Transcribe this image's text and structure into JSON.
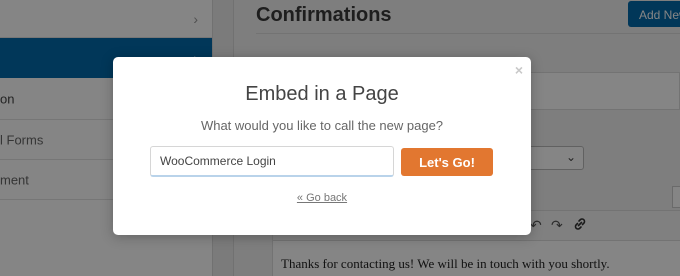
{
  "sidebar": {
    "items": [
      {
        "label": ""
      },
      {
        "label": ""
      },
      {
        "label": "on"
      },
      {
        "label": "l Forms"
      },
      {
        "label": "ment"
      }
    ]
  },
  "main": {
    "title": "Confirmations",
    "add_new_label": "Add New",
    "editor_text": "Thanks for contacting us! We will be in touch with you shortly."
  },
  "icons": {
    "chevron": "chevron-right-icon",
    "undo": "undo-icon",
    "redo": "redo-icon",
    "link": "link-icon",
    "close": "close-icon"
  },
  "modal": {
    "title": "Embed in a Page",
    "subtitle": "What would you like to call the new page?",
    "input_value": "WooCommerce Login",
    "button_label": "Let's Go!",
    "back_link": "« Go back",
    "close_symbol": "×"
  },
  "colors": {
    "accent_blue": "#036aab",
    "button_orange": "#e27730"
  }
}
